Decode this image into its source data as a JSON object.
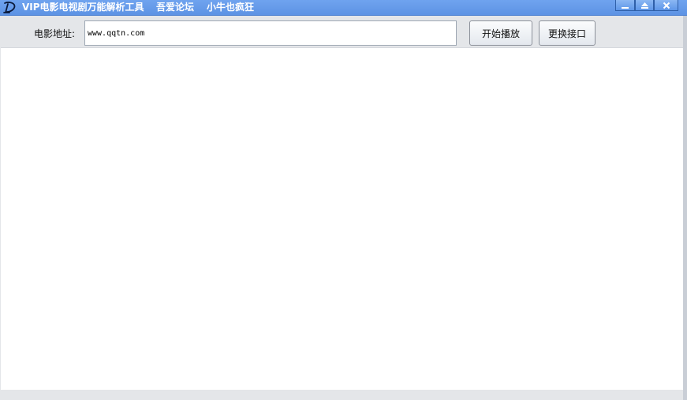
{
  "window": {
    "title": "VIP电影电视剧万能解析工具",
    "links": [
      "吾爱论坛",
      "小牛也疯狂"
    ],
    "controls": {
      "minimize": "minimize-icon",
      "maximize": "maximize-icon",
      "close": "X"
    },
    "accent_color": "#6fa3ef"
  },
  "toolbar": {
    "url_label": "电影地址:",
    "url_value": "www.qqtn.com",
    "play_button": "开始播放",
    "switch_button": "更换接口"
  },
  "status": {
    "text": "",
    "color": "#2d24b8"
  }
}
